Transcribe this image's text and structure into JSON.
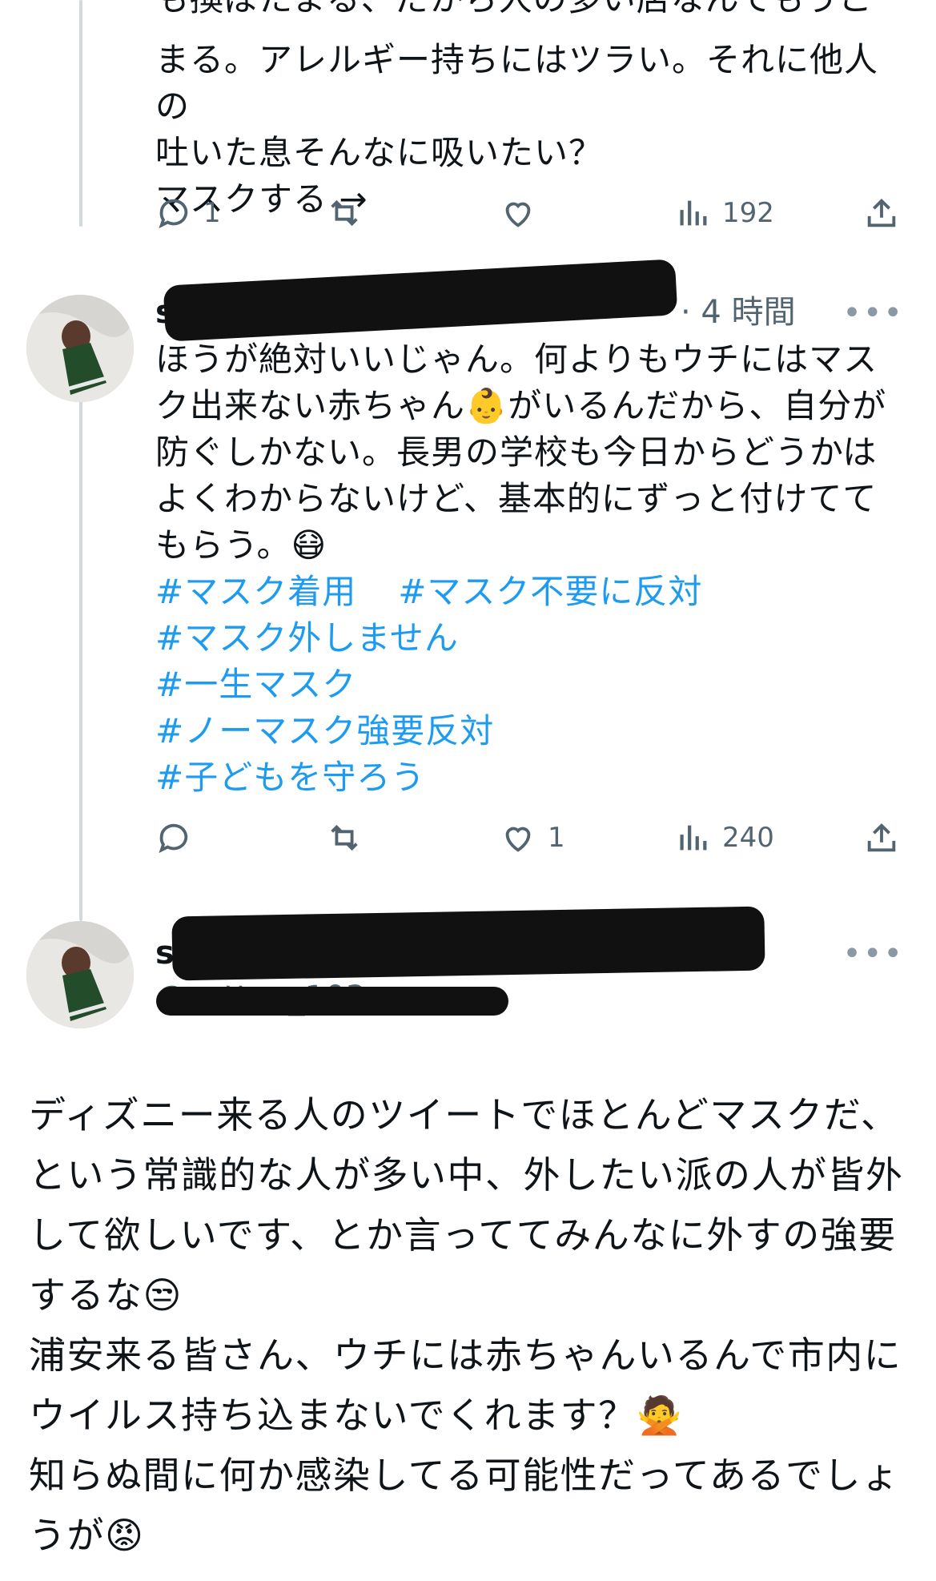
{
  "tweet1": {
    "text_cut": "も換ぼたまる、だから人の多い店なんてもうこた",
    "text": "まる。アレルギー持ちにはツラい。それに他人の\n吐いた息そんなに吸いたい？\nマスクする →",
    "actions": {
      "reply_count": "1",
      "retweet_count": "",
      "like_count": "",
      "views": "192"
    }
  },
  "tweet2": {
    "author_visible": "s",
    "time": "· 4 時間",
    "more": "•••",
    "text": "ほうが絶対いいじゃん。何よりもウチにはマス\nク出来ない赤ちゃん👶がいるんだから、自分が\n防ぐしかない。長男の学校も今日からどうかは\nよくわからないけど、基本的にずっと付けてて\nもらう。😷",
    "hashtags": [
      [
        "#マスク着用",
        "#マスク不要に反対"
      ],
      [
        "#マスク外しません"
      ],
      [
        "#一生マスク"
      ],
      [
        "#ノーマスク強要反対"
      ],
      [
        "#子どもを守ろう"
      ]
    ],
    "actions": {
      "reply_count": "",
      "retweet_count": "",
      "like_count": "1",
      "views": "240"
    }
  },
  "tweet3": {
    "author_visible": "sa",
    "handle_visible": "@satton_103",
    "more": "•••",
    "text": "ディズニー来る人のツイートでほとんどマスクだ、\nという常識的な人が多い中、外したい派の人が皆外\nして欲しいです、とか言っててみんなに外すの強要\nするな😒\n浦安来る皆さん、ウチには赤ちゃんいるんで市内に\nウイルス持ち込まないでくれます？🙅\n知らぬ間に何か感染してる可能性だってあるでしょ\nうが😡"
  },
  "colors": {
    "link": "#1d9bf0",
    "muted": "#536471"
  },
  "icons": [
    "reply-icon",
    "retweet-icon",
    "like-icon",
    "views-icon",
    "share-icon"
  ]
}
